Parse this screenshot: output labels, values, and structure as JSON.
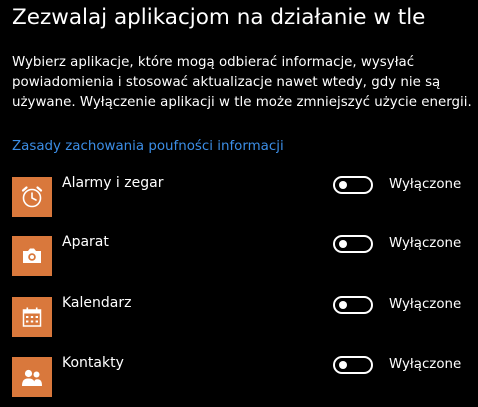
{
  "header": {
    "title": "Zezwalaj aplikacjom na działanie w tle"
  },
  "description": {
    "lines": [
      "Wybierz aplikacje, które mogą odbierać informacje, wysyłać",
      "powiadomienia i stosować aktualizacje nawet wtedy, gdy nie są",
      "używane. Wyłączenie aplikacji w tle może zmniejszyć użycie energii."
    ]
  },
  "privacy_link": {
    "label": "Zasady zachowania poufności informacji"
  },
  "colors": {
    "accent_tile": "#d9783c",
    "link": "#3c8ee6",
    "background": "#000000"
  },
  "apps": [
    {
      "name": "Alarmy i zegar",
      "icon": "alarm-clock-icon",
      "state": "Wyłączone",
      "enabled": false
    },
    {
      "name": "Aparat",
      "icon": "camera-icon",
      "state": "Wyłączone",
      "enabled": false
    },
    {
      "name": "Kalendarz",
      "icon": "calendar-icon",
      "state": "Wyłączone",
      "enabled": false
    },
    {
      "name": "Kontakty",
      "icon": "contacts-icon",
      "state": "Wyłączone",
      "enabled": false
    }
  ]
}
